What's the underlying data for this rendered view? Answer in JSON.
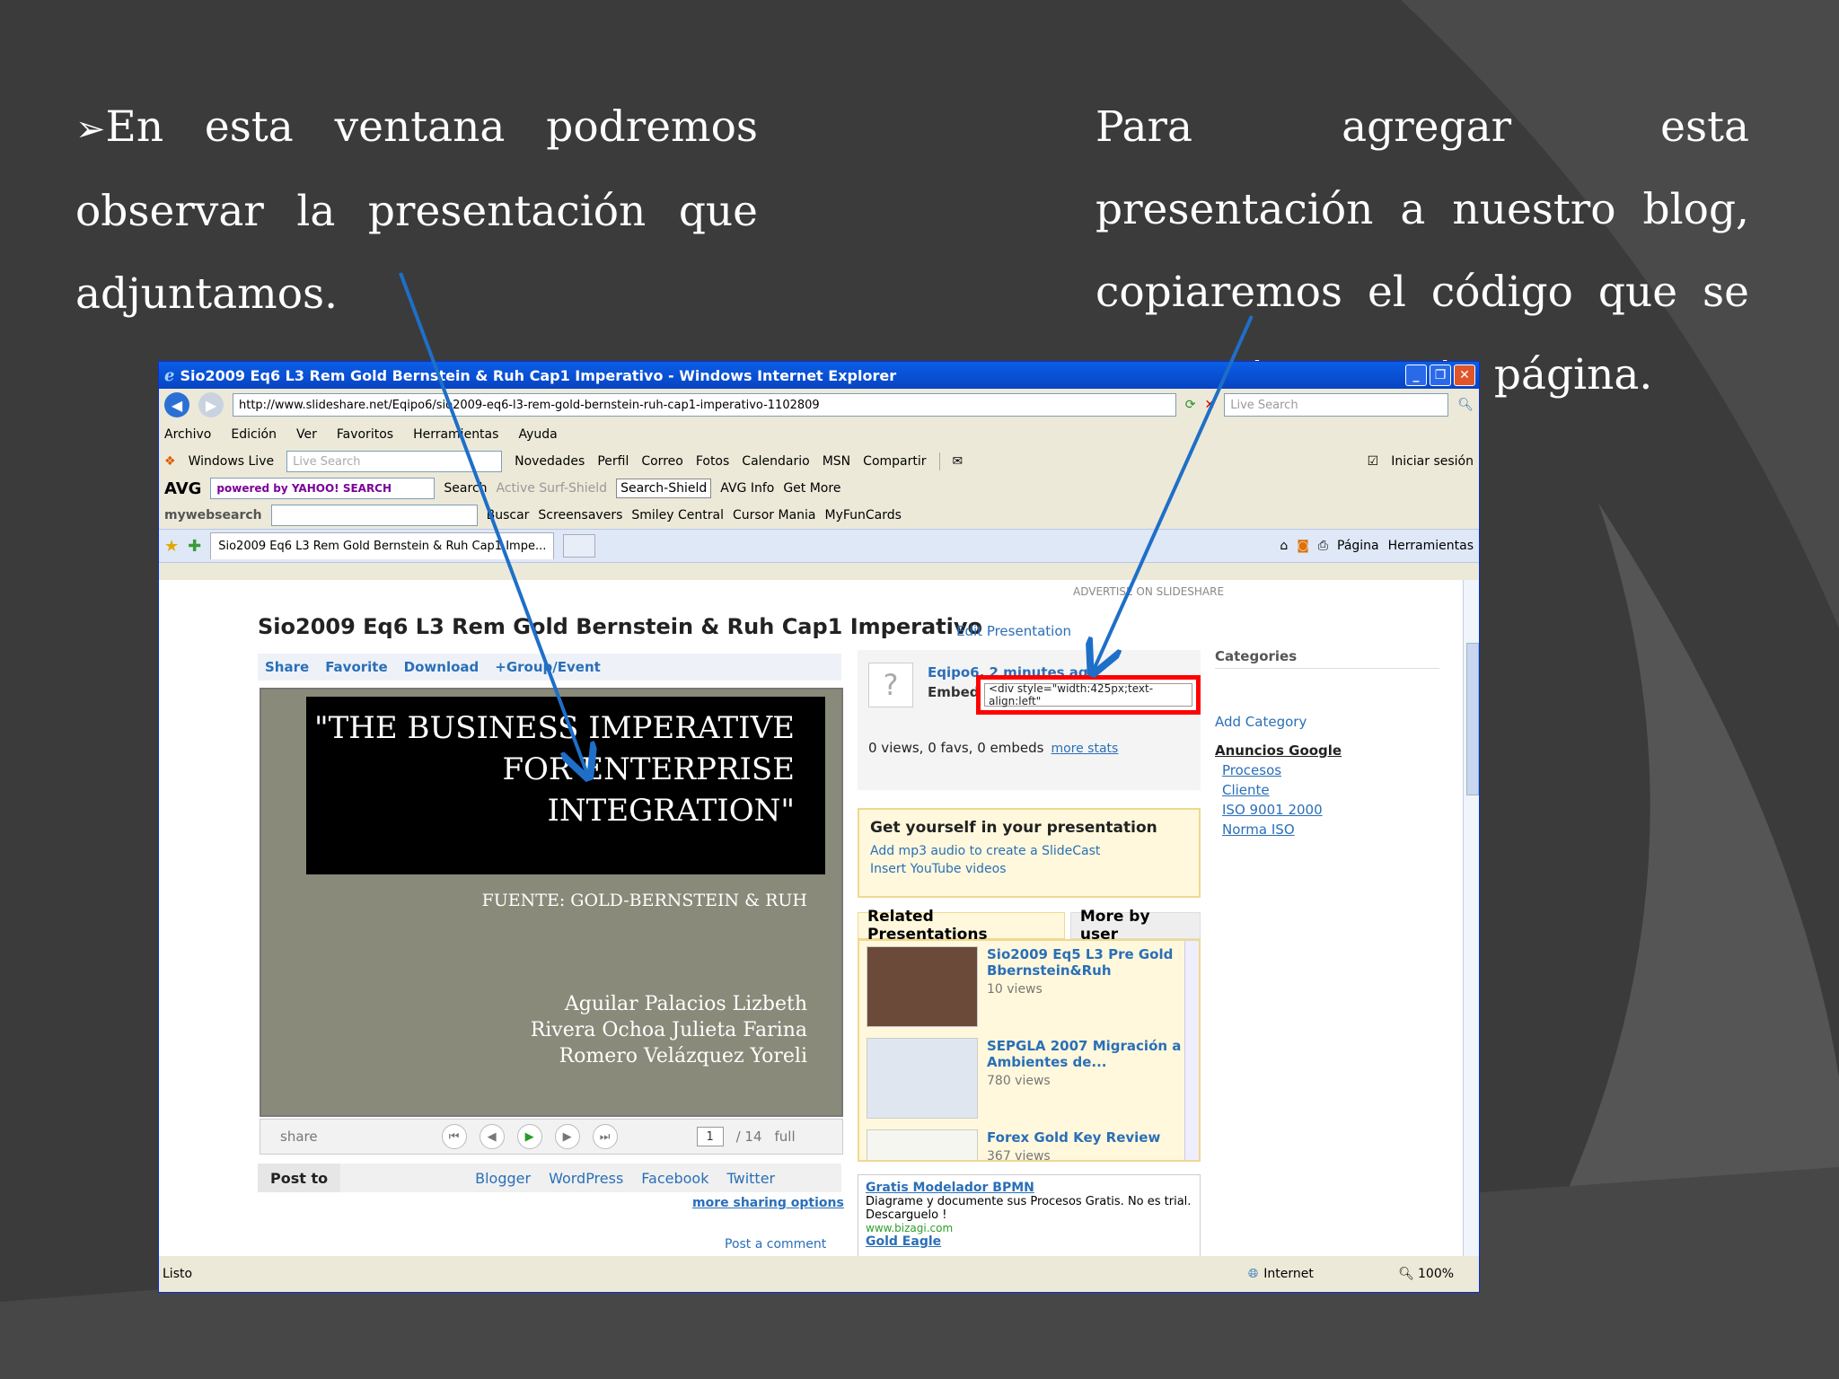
{
  "slide": {
    "left_bullet": "➢",
    "left_lines": [
      "En esta ventana podremos",
      "observar la presentación que",
      "adjuntamos."
    ],
    "right_text": "Para agregar esta presentación a nuestro blog, copiaremos el código que se encuentra en esta página."
  },
  "window": {
    "title": "Sio2009 Eq6 L3 Rem Gold Bernstein & Ruh Cap1 Imperativo - Windows Internet Explorer",
    "url": "http://www.slideshare.net/Eqipo6/sio2009-eq6-l3-rem-gold-bernstein-ruh-cap1-imperativo-1102809",
    "search_placeholder": "Live Search"
  },
  "menubar": [
    "Archivo",
    "Edición",
    "Ver",
    "Favoritos",
    "Herramientas",
    "Ayuda"
  ],
  "windowslive": {
    "label": "Windows Live",
    "search": "Live Search",
    "links": [
      "Novedades",
      "Perfil",
      "Correo",
      "Fotos",
      "Calendario",
      "MSN",
      "Compartir"
    ],
    "signin": "Iniciar sesión"
  },
  "avgbar": {
    "label": "AVG",
    "search_brand": "powered by YAHOO! SEARCH",
    "items": [
      "Search",
      "Active Surf-Shield",
      "Search-Shield",
      "AVG Info",
      "Get More"
    ]
  },
  "mywebsearch": {
    "label": "mywebsearch",
    "items": [
      "Buscar",
      "Screensavers",
      "Smiley Central",
      "Cursor Mania",
      "MyFunCards"
    ]
  },
  "tabs": {
    "active": "Sio2009 Eq6 L3 Rem Gold Bernstein & Ruh Cap1 Impe...",
    "right": [
      "Página",
      "Herramientas"
    ]
  },
  "page": {
    "advertise": "ADVERTISE ON SLIDESHARE",
    "title": "Sio2009 Eq6 L3 Rem Gold Bernstein & Ruh Cap1 Imperativo",
    "edit": "Edit Presentation",
    "actions": [
      "Share",
      "Favorite",
      "Download",
      "+Group/Event"
    ],
    "slide_headline": [
      "\"THE BUSINESS IMPERATIVE",
      "FOR ENTERPRISE",
      "INTEGRATION\""
    ],
    "slide_source": "FUENTE: GOLD-BERNSTEIN & RUH",
    "slide_authors": [
      "Aguilar Palacios Lizbeth",
      "Rivera Ochoa Julieta Farina",
      "Romero Velázquez Yoreli"
    ],
    "player": {
      "share": "share",
      "page": "1",
      "total": "/ 14",
      "full": "full"
    },
    "post_to": "Post to",
    "post_targets": [
      "Blogger",
      "WordPress",
      "Facebook",
      "Twitter"
    ],
    "more_sharing": "more sharing options",
    "post_comment": "Post a comment",
    "owner": "Eqipo6, 2 minutes ago",
    "embed_label": "Embed",
    "embed_code": "<div style=\"width:425px;text-align:left\"",
    "stats": "0 views, 0 favs, 0 embeds",
    "more_stats": "more stats",
    "get_yourself": {
      "title": "Get yourself in your presentation",
      "lines": [
        "Add mp3 audio to create a SlideCast",
        "Insert YouTube videos"
      ]
    },
    "related_tabs": [
      "Related Presentations",
      "More by user"
    ],
    "related": [
      {
        "title": "Sio2009 Eq5 L3 Pre Gold Bbernstein&Ruh",
        "views": "10 views"
      },
      {
        "title": "SEPGLA 2007 Migración a Ambientes de...",
        "views": "780 views"
      },
      {
        "title": "Forex Gold Key Review",
        "views": "367 views"
      }
    ],
    "ad": {
      "title": "Gratis Modelador BPMN",
      "text": "Diagrame y documente sus Procesos Gratis. No es trial. Descarguelo !",
      "url": "www.bizagi.com",
      "next": "Gold Eagle"
    },
    "categories": {
      "title": "Categories",
      "add": "Add Category",
      "ads_title": "Anuncios Google",
      "links": [
        "Procesos",
        "Cliente",
        "ISO 9001 2000",
        "Norma ISO"
      ]
    }
  },
  "status": {
    "text": "Listo",
    "zone": "Internet",
    "zoom": "100%"
  },
  "colors": {
    "arrow": "#1e6fc8",
    "highlight": "#ff0000",
    "xp_blue": "#0a5ee8"
  }
}
